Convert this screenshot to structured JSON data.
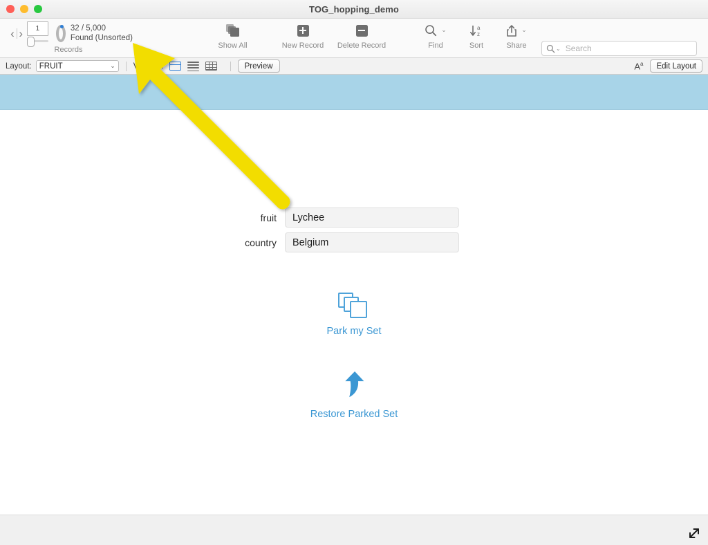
{
  "window": {
    "title": "TOG_hopping_demo",
    "traffic_lights": [
      "close-red",
      "minimize-yellow",
      "maximize-green"
    ]
  },
  "toolbar": {
    "prev_arrow": "‹",
    "next_arrow": "›",
    "record_number": "1",
    "found_count_line1": "32 / 5,000",
    "found_count_line2": "Found (Unsorted)",
    "records_label": "Records",
    "buttons": [
      {
        "name": "show-all",
        "label": "Show All",
        "icon": "stack-icon"
      },
      {
        "name": "new-record",
        "label": "New Record",
        "icon": "plus-square-icon"
      },
      {
        "name": "delete-record",
        "label": "Delete Record",
        "icon": "minus-square-icon"
      },
      {
        "name": "find",
        "label": "Find",
        "icon": "magnifier-icon"
      },
      {
        "name": "sort",
        "label": "Sort",
        "icon": "sort-az-icon"
      },
      {
        "name": "share",
        "label": "Share",
        "icon": "share-icon"
      }
    ],
    "search_placeholder": "Search",
    "search_value": ""
  },
  "layout_bar": {
    "layout_label": "Layout:",
    "layout_value": "FRUIT",
    "view_as_label": "View As:",
    "view_modes": [
      "form-view-icon",
      "list-view-icon",
      "table-view-icon"
    ],
    "active_view": "form-view-icon",
    "preview_label": "Preview",
    "text_format_icon": "font-size-icon",
    "edit_layout_label": "Edit Layout"
  },
  "record": {
    "fields": [
      {
        "label": "fruit",
        "value": "Lychee"
      },
      {
        "label": "country",
        "value": "Belgium"
      }
    ]
  },
  "script_buttons": [
    {
      "name": "park-my-set",
      "label": "Park my Set",
      "icon": "stacked-windows-icon"
    },
    {
      "name": "restore-parked-set",
      "label": "Restore Parked Set",
      "icon": "curved-arrow-up-left-icon"
    }
  ],
  "annotation": {
    "type": "pointer-arrow",
    "color": "#F2DD00",
    "points_at": "records-navigation-cluster"
  },
  "colors": {
    "header_band": "#A8D4E8",
    "accent_blue": "#3B97D3",
    "icon_blue": "#4FA3DA",
    "annotation_yellow": "#F2DD00",
    "footer_gray": "#F0F0F0"
  },
  "footer": {
    "resize_handle": "resize-grip-icon"
  }
}
